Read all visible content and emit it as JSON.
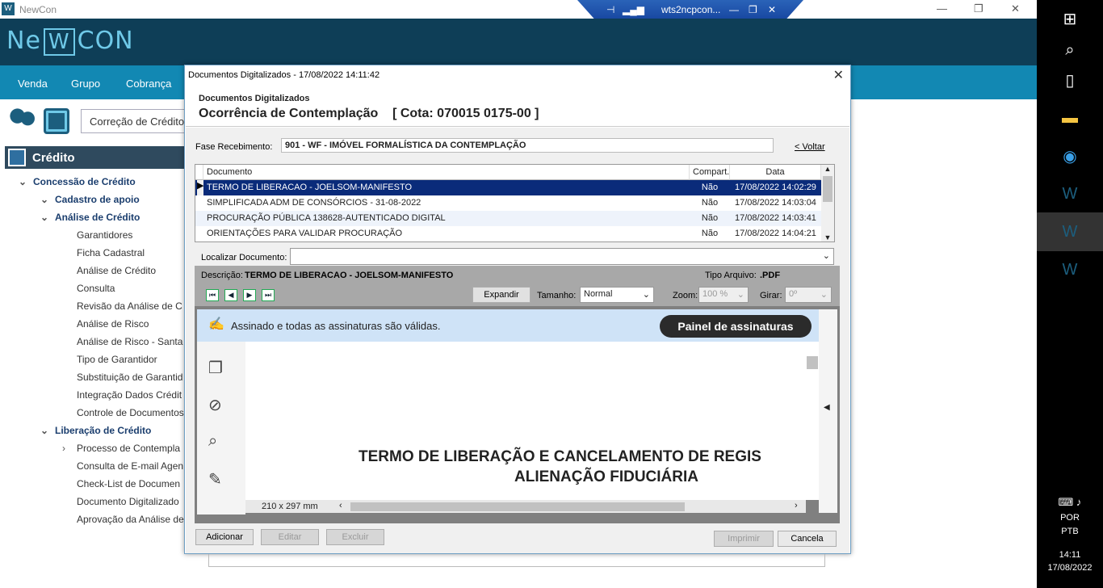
{
  "window": {
    "title": "NewCon",
    "rdp_title": "wts2ncpcon..."
  },
  "brand": {
    "pre": "Ne",
    "mid": "W",
    "post": "CON"
  },
  "menu": [
    "Venda",
    "Grupo",
    "Cobrança"
  ],
  "breadcrumb": "Correção de Crédito",
  "panel": {
    "title": "Crédito"
  },
  "tree": [
    {
      "label": "Concessão de Crédito",
      "level": 0,
      "bold": true,
      "chevron": "⌄"
    },
    {
      "label": "Cadastro de apoio",
      "level": 1,
      "bold": true,
      "chevron": "⌄"
    },
    {
      "label": "Análise de Crédito",
      "level": 1,
      "bold": true,
      "chevron": "⌄"
    },
    {
      "label": "Garantidores",
      "level": 2
    },
    {
      "label": "Ficha Cadastral",
      "level": 2
    },
    {
      "label": "Análise de Crédito",
      "level": 2
    },
    {
      "label": "Consulta",
      "level": 2
    },
    {
      "label": "Revisão da Análise de C",
      "level": 2
    },
    {
      "label": "Análise de Risco",
      "level": 2
    },
    {
      "label": "Análise de Risco - Santa",
      "level": 2
    },
    {
      "label": "Tipo de Garantidor",
      "level": 2
    },
    {
      "label": "Substituição de Garantid",
      "level": 2
    },
    {
      "label": "Integração Dados Crédit",
      "level": 2
    },
    {
      "label": "Controle de Documentos",
      "level": 2
    },
    {
      "label": "Liberação de Crédito",
      "level": 1,
      "bold": true,
      "chevron": "⌄"
    },
    {
      "label": "Processo de Contempla",
      "level": 2,
      "chevron": "›"
    },
    {
      "label": "Consulta de E-mail Agen",
      "level": 2
    },
    {
      "label": "Check-List de Documen",
      "level": 2
    },
    {
      "label": "Documento Digitalizado",
      "level": 2
    },
    {
      "label": "Aprovação da Análise de",
      "level": 2
    }
  ],
  "dialog": {
    "title": "Documentos Digitalizados - 17/08/2022  14:11:42",
    "subtitle": "Documentos Digitalizados",
    "heading": "Ocorrência de Contemplação    [ Cota: 070015 0175-00 ]",
    "fase_label": "Fase Recebimento:",
    "fase_value": "901 - WF - IMÓVEL FORMALÍSTICA DA CONTEMPLAÇÃO",
    "voltar": "< Voltar",
    "columns": [
      "Documento",
      "Compart.",
      "Data"
    ],
    "rows": [
      {
        "doc": "TERMO DE LIBERACAO - JOELSOM-MANIFESTO",
        "comp": "Não",
        "date": "17/08/2022 14:02:29"
      },
      {
        "doc": "SIMPLIFICADA ADM DE CONSÓRCIOS - 31-08-2022",
        "comp": "Não",
        "date": "17/08/2022 14:03:04"
      },
      {
        "doc": "PROCURAÇÃO PÚBLICA 138628-AUTENTICADO DIGITAL",
        "comp": "Não",
        "date": "17/08/2022 14:03:41"
      },
      {
        "doc": "ORIENTAÇÕES PARA VALIDAR PROCURAÇÃO",
        "comp": "Não",
        "date": "17/08/2022 14:04:21"
      }
    ],
    "localizar_label": "Localizar Documento:",
    "descricao_label": "Descrição:",
    "descricao_value": "TERMO DE LIBERACAO - JOELSOM-MANIFESTO",
    "tipo_label": "Tipo Arquivo:",
    "tipo_value": ".PDF",
    "expandir": "Expandir",
    "tamanho_label": "Tamanho:",
    "tamanho_value": "Normal",
    "zoom_label": "Zoom:",
    "zoom_value": "100 %",
    "girar_label": "Girar:",
    "girar_value": "0º",
    "sig_text": "Assinado e todas as assinaturas são válidas.",
    "sig_button": "Painel de assinaturas",
    "pdf_line1": "TERMO DE LIBERAÇÃO E CANCELAMENTO DE REGIS",
    "pdf_line2": "ALIENAÇÃO FIDUCIÁRIA",
    "page_size": "210 x 297 mm",
    "btn_add": "Adicionar",
    "btn_edit": "Editar",
    "btn_del": "Excluir",
    "btn_print": "Imprimir",
    "btn_cancel": "Cancela"
  },
  "taskbar": {
    "lang1": "POR",
    "lang2": "PTB",
    "time": "14:11",
    "date": "17/08/2022"
  }
}
